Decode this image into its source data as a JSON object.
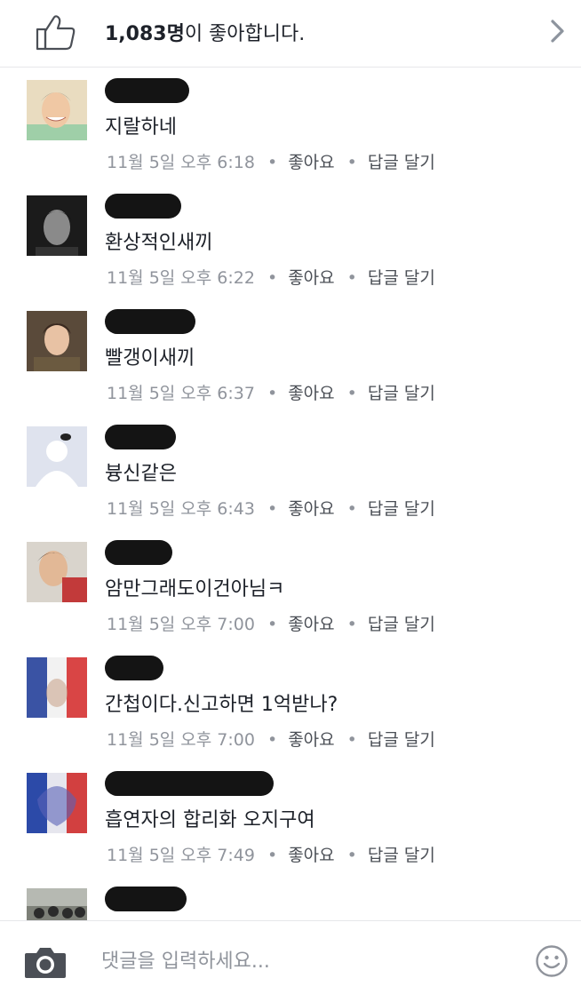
{
  "likes": {
    "count": "1,083명",
    "suffix": "이 좋아합니다.",
    "icon": "thumbs-up-icon"
  },
  "comments": [
    {
      "text": "지랄하네",
      "time": "11월 5일 오후 6:18",
      "like": "좋아요",
      "reply": "답글 달기"
    },
    {
      "text": "환상적인새끼",
      "time": "11월 5일 오후 6:22",
      "like": "좋아요",
      "reply": "답글 달기"
    },
    {
      "text": "빨갱이새끼",
      "time": "11월 5일 오후 6:37",
      "like": "좋아요",
      "reply": "답글 달기"
    },
    {
      "text": "븅신같은",
      "time": "11월 5일 오후 6:43",
      "like": "좋아요",
      "reply": "답글 달기"
    },
    {
      "text": "암만그래도이건아님ㅋ",
      "time": "11월 5일 오후 7:00",
      "like": "좋아요",
      "reply": "답글 달기"
    },
    {
      "text": "간첩이다.신고하면 1억받나?",
      "time": "11월 5일 오후 7:00",
      "like": "좋아요",
      "reply": "답글 달기"
    },
    {
      "text": "흡연자의 합리화 오지구여",
      "time": "11월 5일 오후 7:49",
      "like": "좋아요",
      "reply": "답글 달기"
    }
  ],
  "separator": "•",
  "composer": {
    "placeholder": "댓글을 입력하세요...",
    "camera_icon": "camera-icon",
    "emoji_icon": "smiley-icon"
  },
  "colors": {
    "text": "#1d2129",
    "meta": "#90949c",
    "action": "#4b4f56",
    "divider": "#e6e7ea"
  }
}
